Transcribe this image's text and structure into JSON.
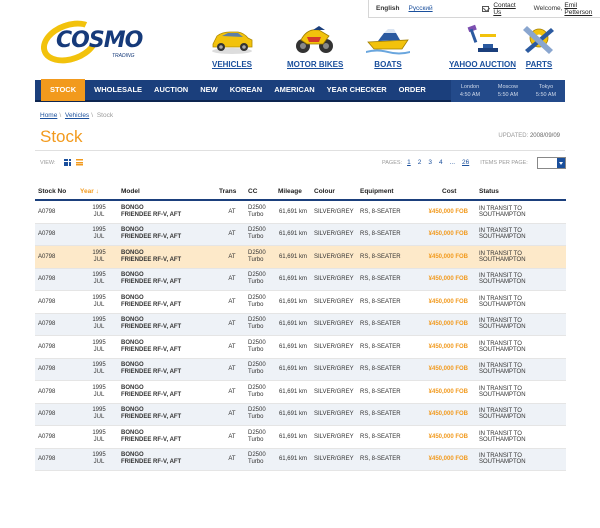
{
  "topbar": {
    "lang_en": "English",
    "lang_ru": "Русский",
    "contact": "Contact Us",
    "welcome": "Welcome,",
    "user": "Emil Petterson"
  },
  "logo": {
    "word": "COSMO",
    "tag": "TRADING"
  },
  "categories": [
    {
      "label": "VEHICLES",
      "icon": "car-icon"
    },
    {
      "label": "MOTOR BIKES",
      "icon": "motorbike-icon"
    },
    {
      "label": "BOATS",
      "icon": "boat-icon"
    },
    {
      "label": "YAHOO AUCTION",
      "icon": "yahoo-auction-icon"
    },
    {
      "label": "PARTS",
      "icon": "parts-icon"
    }
  ],
  "nav": {
    "items": [
      "STOCK",
      "WHOLESALE",
      "AUCTION",
      "NEW",
      "KOREAN",
      "AMERICAN",
      "YEAR CHECKER",
      "ORDER"
    ],
    "clocks": [
      {
        "city": "London",
        "time": "4:50 AM"
      },
      {
        "city": "Moscow",
        "time": "5:50 AM"
      },
      {
        "city": "Tokyo",
        "time": "5:50 AM"
      }
    ]
  },
  "breadcrumb": {
    "home": "Home",
    "vehicles": "Vehicles",
    "current": "Stock"
  },
  "page": {
    "title": "Stock",
    "updated_label": "UPDATED:",
    "updated_date": "2008/09/09"
  },
  "view": {
    "label": "VIEW:"
  },
  "pager": {
    "label": "PAGES:",
    "pages": [
      "1",
      "2",
      "3",
      "4",
      "...",
      "26"
    ],
    "items_per_page_label": "ITEMS PER PAGE:"
  },
  "table": {
    "headers": {
      "stock_no": "Stock No",
      "year": "Year",
      "year_sort": "↓",
      "model": "Model",
      "trans": "Trans",
      "cc": "CC",
      "mileage": "Mileage",
      "colour": "Colour",
      "equipment": "Equipment",
      "cost": "Cost",
      "status": "Status"
    },
    "rows": [
      {
        "stock_no": "A0798",
        "year": "1995",
        "month": "JUL",
        "model1": "BONGO",
        "model2": "FRIENDEE RF-V, AFT",
        "trans": "AT",
        "cc1": "D2500",
        "cc2": "Turbo",
        "mileage": "61,691 km",
        "colour": "SILVER/GREY",
        "equipment": "RS, 8-SEATER",
        "cost": "¥450,000 FOB",
        "status": "IN TRANSIT TO SOUTHAMPTON"
      },
      {
        "stock_no": "A0798",
        "year": "1995",
        "month": "JUL",
        "model1": "BONGO",
        "model2": "FRIENDEE RF-V, AFT",
        "trans": "AT",
        "cc1": "D2500",
        "cc2": "Turbo",
        "mileage": "61,691 km",
        "colour": "SILVER/GREY",
        "equipment": "RS, 8-SEATER",
        "cost": "¥450,000 FOB",
        "status": "IN TRANSIT TO SOUTHAMPTON"
      },
      {
        "stock_no": "A0798",
        "year": "1995",
        "month": "JUL",
        "model1": "BONGO",
        "model2": "FRIENDEE RF-V, AFT",
        "trans": "AT",
        "cc1": "D2500",
        "cc2": "Turbo",
        "mileage": "61,691 km",
        "colour": "SILVER/GREY",
        "equipment": "RS, 8-SEATER",
        "cost": "¥450,000 FOB",
        "status": "IN TRANSIT TO SOUTHAMPTON"
      },
      {
        "stock_no": "A0798",
        "year": "1995",
        "month": "JUL",
        "model1": "BONGO",
        "model2": "FRIENDEE RF-V, AFT",
        "trans": "AT",
        "cc1": "D2500",
        "cc2": "Turbo",
        "mileage": "61,691 km",
        "colour": "SILVER/GREY",
        "equipment": "RS, 8-SEATER",
        "cost": "¥450,000 FOB",
        "status": "IN TRANSIT TO SOUTHAMPTON"
      },
      {
        "stock_no": "A0798",
        "year": "1995",
        "month": "JUL",
        "model1": "BONGO",
        "model2": "FRIENDEE RF-V, AFT",
        "trans": "AT",
        "cc1": "D2500",
        "cc2": "Turbo",
        "mileage": "61,691 km",
        "colour": "SILVER/GREY",
        "equipment": "RS, 8-SEATER",
        "cost": "¥450,000 FOB",
        "status": "IN TRANSIT TO SOUTHAMPTON"
      },
      {
        "stock_no": "A0798",
        "year": "1995",
        "month": "JUL",
        "model1": "BONGO",
        "model2": "FRIENDEE RF-V, AFT",
        "trans": "AT",
        "cc1": "D2500",
        "cc2": "Turbo",
        "mileage": "61,691 km",
        "colour": "SILVER/GREY",
        "equipment": "RS, 8-SEATER",
        "cost": "¥450,000 FOB",
        "status": "IN TRANSIT TO SOUTHAMPTON"
      },
      {
        "stock_no": "A0798",
        "year": "1995",
        "month": "JUL",
        "model1": "BONGO",
        "model2": "FRIENDEE RF-V, AFT",
        "trans": "AT",
        "cc1": "D2500",
        "cc2": "Turbo",
        "mileage": "61,691 km",
        "colour": "SILVER/GREY",
        "equipment": "RS, 8-SEATER",
        "cost": "¥450,000 FOB",
        "status": "IN TRANSIT TO SOUTHAMPTON"
      },
      {
        "stock_no": "A0798",
        "year": "1995",
        "month": "JUL",
        "model1": "BONGO",
        "model2": "FRIENDEE RF-V, AFT",
        "trans": "AT",
        "cc1": "D2500",
        "cc2": "Turbo",
        "mileage": "61,691 km",
        "colour": "SILVER/GREY",
        "equipment": "RS, 8-SEATER",
        "cost": "¥450,000 FOB",
        "status": "IN TRANSIT TO SOUTHAMPTON"
      },
      {
        "stock_no": "A0798",
        "year": "1995",
        "month": "JUL",
        "model1": "BONGO",
        "model2": "FRIENDEE RF-V, AFT",
        "trans": "AT",
        "cc1": "D2500",
        "cc2": "Turbo",
        "mileage": "61,691 km",
        "colour": "SILVER/GREY",
        "equipment": "RS, 8-SEATER",
        "cost": "¥450,000 FOB",
        "status": "IN TRANSIT TO SOUTHAMPTON"
      },
      {
        "stock_no": "A0798",
        "year": "1995",
        "month": "JUL",
        "model1": "BONGO",
        "model2": "FRIENDEE RF-V, AFT",
        "trans": "AT",
        "cc1": "D2500",
        "cc2": "Turbo",
        "mileage": "61,691 km",
        "colour": "SILVER/GREY",
        "equipment": "RS, 8-SEATER",
        "cost": "¥450,000 FOB",
        "status": "IN TRANSIT TO SOUTHAMPTON"
      },
      {
        "stock_no": "A0798",
        "year": "1995",
        "month": "JUL",
        "model1": "BONGO",
        "model2": "FRIENDEE RF-V, AFT",
        "trans": "AT",
        "cc1": "D2500",
        "cc2": "Turbo",
        "mileage": "61,691 km",
        "colour": "SILVER/GREY",
        "equipment": "RS, 8-SEATER",
        "cost": "¥450,000 FOB",
        "status": "IN TRANSIT TO SOUTHAMPTON"
      },
      {
        "stock_no": "A0798",
        "year": "1995",
        "month": "JUL",
        "model1": "BONGO",
        "model2": "FRIENDEE RF-V, AFT",
        "trans": "AT",
        "cc1": "D2500",
        "cc2": "Turbo",
        "mileage": "61,691 km",
        "colour": "SILVER/GREY",
        "equipment": "RS, 8-SEATER",
        "cost": "¥450,000 FOB",
        "status": "IN TRANSIT TO SOUTHAMPTON"
      }
    ]
  },
  "colors": {
    "navy": "#1b3f7c",
    "orange": "#f29a1d",
    "link": "#1a4f9c",
    "row_alt": "#eef2f7",
    "row_highlight": "#fde9c9"
  }
}
